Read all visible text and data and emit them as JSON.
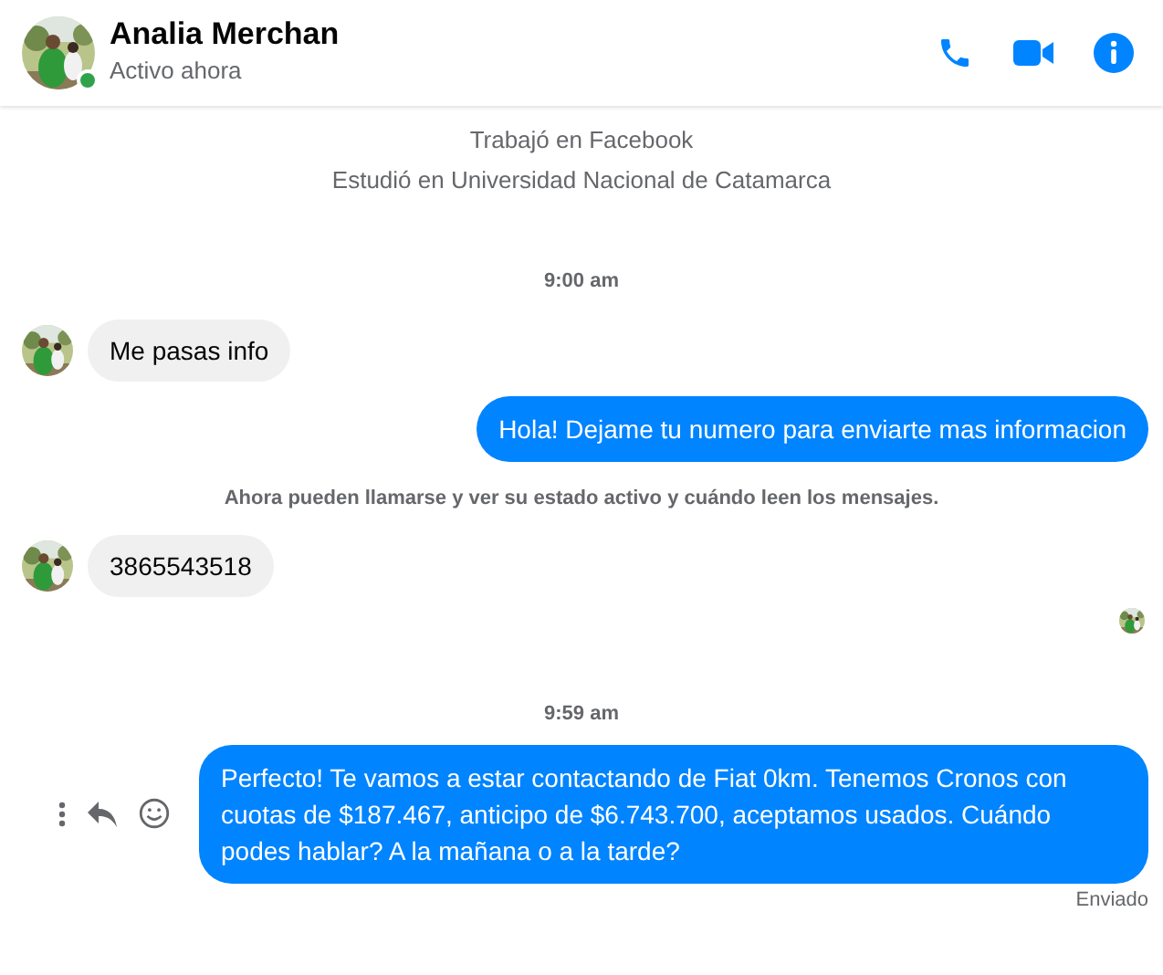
{
  "header": {
    "name": "Analia Merchan",
    "status": "Activo ahora",
    "online": true
  },
  "messages": [
    {
      "kind": "info",
      "text": "Trabajó en Facebook"
    },
    {
      "kind": "info",
      "text": "Estudió en Universidad Nacional de Catamarca"
    },
    {
      "kind": "time",
      "text": "9:00 am"
    },
    {
      "kind": "incoming",
      "text": "Me pasas info"
    },
    {
      "kind": "outgoing",
      "text": "Hola! Dejame tu numero para enviarte mas informacion"
    },
    {
      "kind": "notice",
      "text": "Ahora pueden llamarse y ver su estado activo y cuándo leen los mensajes."
    },
    {
      "kind": "incoming",
      "text": "3865543518"
    },
    {
      "kind": "seen"
    },
    {
      "kind": "time",
      "text": "9:59 am"
    },
    {
      "kind": "outgoing",
      "text": "Perfecto! Te vamos a estar contactando de Fiat 0km. Tenemos Cronos con cuotas de $187.467, anticipo de $6.743.700, aceptamos usados. Cuándo podes hablar? A la mañana o a la tarde?",
      "actions": true
    },
    {
      "kind": "status",
      "text": "Enviado"
    }
  ]
}
